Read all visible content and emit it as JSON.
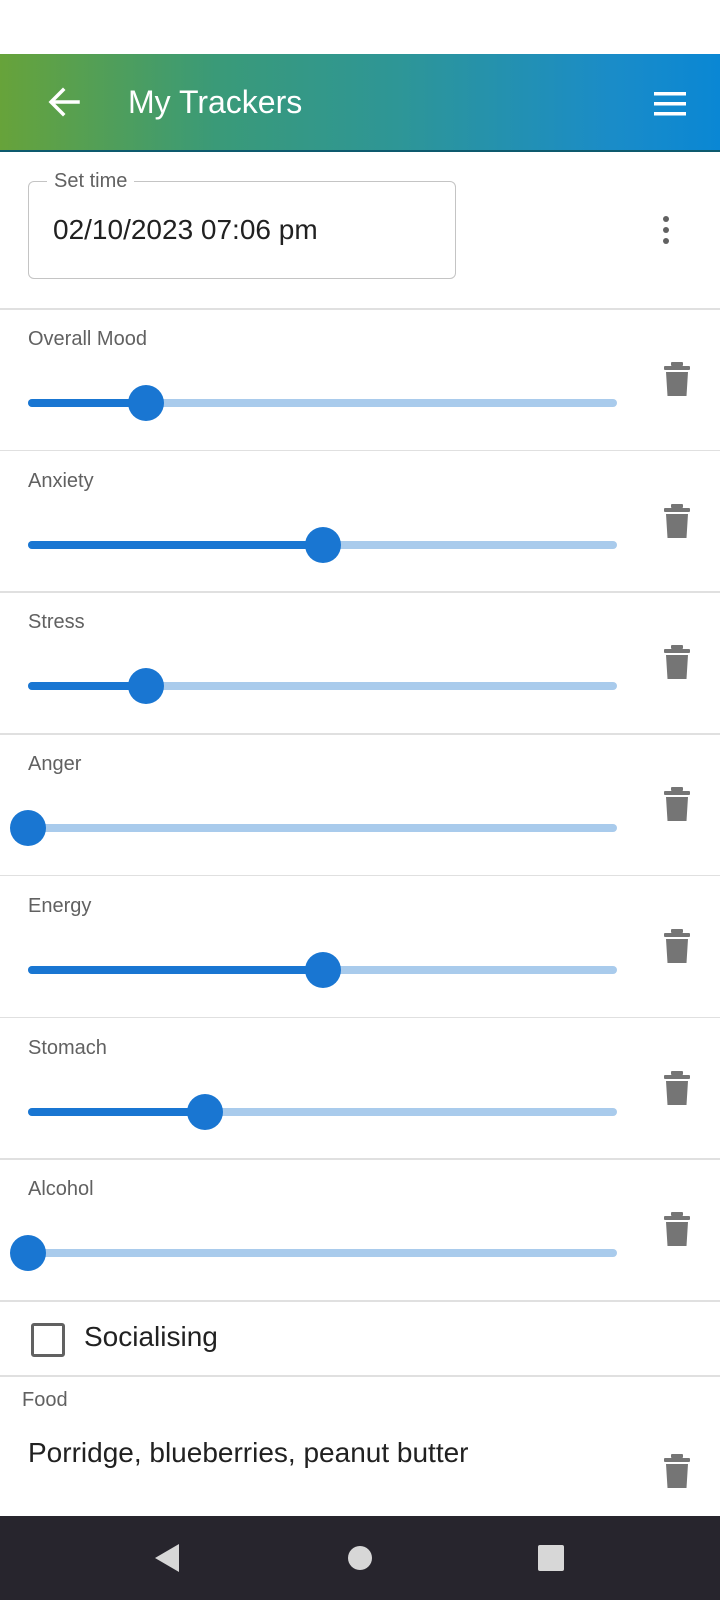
{
  "app_bar": {
    "title": "My Trackers",
    "back_icon": "arrow-back-icon",
    "menu_icon": "hamburger-menu-icon",
    "gradient": [
      "#67a33a",
      "#2e9696",
      "#0a87d4"
    ]
  },
  "time_field": {
    "label": "Set time",
    "value": "02/10/2023 07:06 pm",
    "more_icon": "more-vert-icon"
  },
  "trackers": [
    {
      "label": "Overall Mood",
      "value_fraction": 0.2
    },
    {
      "label": "Anxiety",
      "value_fraction": 0.5
    },
    {
      "label": "Stress",
      "value_fraction": 0.2
    },
    {
      "label": "Anger",
      "value_fraction": 0.0
    },
    {
      "label": "Energy",
      "value_fraction": 0.5
    },
    {
      "label": "Stomach",
      "value_fraction": 0.3
    },
    {
      "label": "Alcohol",
      "value_fraction": 0.0
    }
  ],
  "socialising": {
    "label": "Socialising",
    "checked": false
  },
  "food": {
    "label": "Food",
    "value": "Porridge, blueberries, peanut butter"
  },
  "colors": {
    "accent": "#1976d2",
    "track_inactive": "#a9cbec",
    "delete_icon": "#757575",
    "nav_bar": "#27252d"
  },
  "icons": {
    "delete": "trash-icon",
    "nav_back": "nav-back-triangle-icon",
    "nav_home": "nav-home-circle-icon",
    "nav_recents": "nav-recents-square-icon"
  }
}
